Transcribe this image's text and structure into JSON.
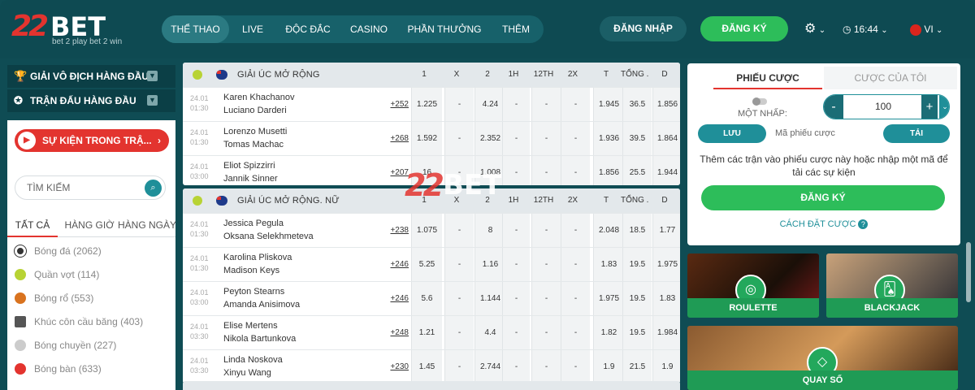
{
  "brand": {
    "logo_number": "22",
    "logo_word": "BET",
    "tagline": "bet 2 play bet 2 win"
  },
  "nav": [
    "THỂ THAO",
    "LIVE",
    "ĐỘC ĐẮC",
    "CASINO",
    "PHẦN THƯỞNG",
    "THÊM"
  ],
  "header": {
    "login": "ĐĂNG NHẬP",
    "register": "ĐĂNG KÝ",
    "time": "16:44",
    "lang": "VI"
  },
  "left": {
    "top_leagues": "GIẢI VÔ ĐỊCH HÀNG ĐẦU",
    "top_matches": "TRẬN ĐẤU HÀNG ĐẦU",
    "events": "SỰ KIỆN TRONG TRẬ...",
    "search_placeholder": "TÌM KIẾM",
    "tabs": [
      "TẤT CẢ",
      "HÀNG GIỜ",
      "HÀNG NGÀY"
    ],
    "sports": [
      {
        "label": "Bóng đá (2062)",
        "color": "#333333"
      },
      {
        "label": "Quần vợt (114)",
        "color": "#b8d334"
      },
      {
        "label": "Bóng rổ (553)",
        "color": "#d9731f"
      },
      {
        "label": "Khúc côn cầu băng (403)",
        "color": "#555555"
      },
      {
        "label": "Bóng chuyền (227)",
        "color": "#cccccc"
      },
      {
        "label": "Bóng bàn (633)",
        "color": "#e3342f"
      }
    ]
  },
  "columns": [
    "1",
    "X",
    "2",
    "1H",
    "12TH",
    "2X",
    "T",
    "TỔNG ...",
    "D"
  ],
  "leagues": [
    {
      "name": "GIẢI ÚC MỞ RỘNG",
      "rows": [
        {
          "date": "24.01",
          "time": "01:30",
          "p1": "Karen Khachanov",
          "p2": "Luciano Darderi",
          "more": "+252",
          "odds": [
            "1.225",
            "-",
            "4.24",
            "-",
            "-",
            "-",
            "1.945",
            "36.5",
            "1.856"
          ]
        },
        {
          "date": "24.01",
          "time": "01:30",
          "p1": "Lorenzo Musetti",
          "p2": "Tomas Machac",
          "more": "+268",
          "odds": [
            "1.592",
            "-",
            "2.352",
            "-",
            "-",
            "-",
            "1.936",
            "39.5",
            "1.864"
          ]
        },
        {
          "date": "24.01",
          "time": "03:00",
          "p1": "Eliot Spizzirri",
          "p2": "Jannik Sinner",
          "more": "+207",
          "odds": [
            "16",
            "-",
            "1.008",
            "-",
            "-",
            "-",
            "1.856",
            "25.5",
            "1.944"
          ]
        }
      ]
    },
    {
      "name": "GIẢI ÚC MỞ RỘNG. NỮ",
      "rows": [
        {
          "date": "24.01",
          "time": "01:30",
          "p1": "Jessica Pegula",
          "p2": "Oksana Selekhmeteva",
          "more": "+238",
          "odds": [
            "1.075",
            "-",
            "8",
            "-",
            "-",
            "-",
            "2.048",
            "18.5",
            "1.77"
          ]
        },
        {
          "date": "24.01",
          "time": "01:30",
          "p1": "Karolina Pliskova",
          "p2": "Madison Keys",
          "more": "+246",
          "odds": [
            "5.25",
            "-",
            "1.16",
            "-",
            "-",
            "-",
            "1.83",
            "19.5",
            "1.975"
          ]
        },
        {
          "date": "24.01",
          "time": "03:00",
          "p1": "Peyton Stearns",
          "p2": "Amanda Anisimova",
          "more": "+246",
          "odds": [
            "5.6",
            "-",
            "1.144",
            "-",
            "-",
            "-",
            "1.975",
            "19.5",
            "1.83"
          ]
        },
        {
          "date": "24.01",
          "time": "03:30",
          "p1": "Elise Mertens",
          "p2": "Nikola Bartunkova",
          "more": "+248",
          "odds": [
            "1.21",
            "-",
            "4.4",
            "-",
            "-",
            "-",
            "1.82",
            "19.5",
            "1.984"
          ]
        },
        {
          "date": "24.01",
          "time": "03:30",
          "p1": "Linda Noskova",
          "p2": "Xinyu Wang",
          "more": "+230",
          "odds": [
            "1.45",
            "-",
            "2.744",
            "-",
            "-",
            "-",
            "1.9",
            "21.5",
            "1.9"
          ]
        }
      ]
    }
  ],
  "slip": {
    "tab_active": "PHIẾU CƯỢC",
    "tab_other": "CƯỢC CỦA TÔI",
    "one_click": "MỘT NHẤP:",
    "stake": "100",
    "minus": "-",
    "plus": "+",
    "save": "LƯU",
    "code_placeholder": "Mã phiếu cược",
    "load": "TẢI",
    "info": "Thêm các trận vào phiếu cược này hoặc nhập một mã để tải các sự kiện",
    "register": "ĐĂNG KÝ",
    "how": "CÁCH ĐẶT CƯỢC"
  },
  "tiles": [
    "ROULETTE",
    "BLACKJACK",
    "QUAY SỐ"
  ]
}
